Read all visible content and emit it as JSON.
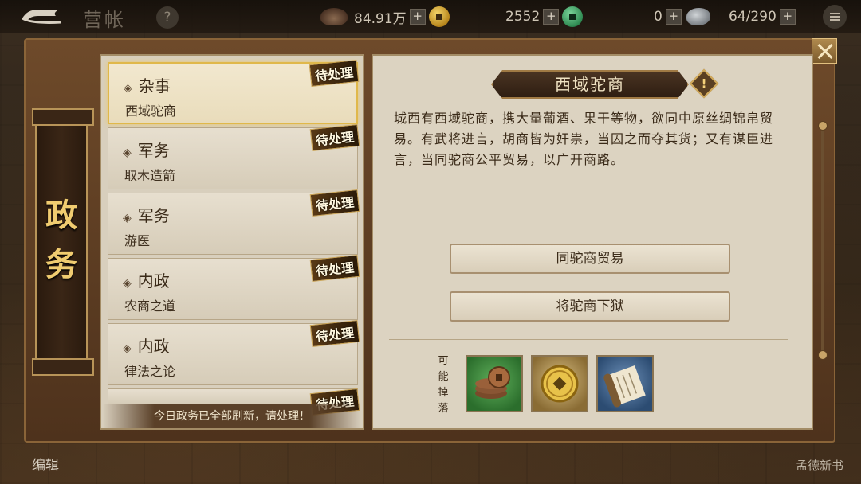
{
  "topbar": {
    "title": "营帐",
    "help_label": "?",
    "resources": [
      {
        "icon": "ingot-icon",
        "value": "84.91万"
      },
      {
        "icon": "jade-coin-icon",
        "value": "2552"
      },
      {
        "icon": "stone-icon",
        "value": "0"
      },
      {
        "icon": "capacity",
        "value": "64/290"
      }
    ],
    "plus_label": "+"
  },
  "sidebar": {
    "title": "政务"
  },
  "affairs": {
    "pending_label": "待处理",
    "partial_label": "待处理",
    "items": [
      {
        "category": "杂事",
        "name": "西域驼商",
        "selected": true
      },
      {
        "category": "军务",
        "name": "取木造箭",
        "selected": false
      },
      {
        "category": "军务",
        "name": "游医",
        "selected": false
      },
      {
        "category": "内政",
        "name": "农商之道",
        "selected": false
      },
      {
        "category": "内政",
        "name": "律法之论",
        "selected": false
      }
    ],
    "footer": "今日政务已全部刷新，请处理！"
  },
  "detail": {
    "title": "西域驼商",
    "alert_label": "!",
    "description": "城西有西域驼商，携大量葡酒、果干等物，欲同中原丝绸锦帛贸易。有武将进言，胡商皆为奸祟，当囚之而夺其货；又有谋臣进言，当同驼商公平贸易，以广开商路。",
    "choices": [
      "同驼商贸易",
      "将驼商下狱"
    ],
    "drops_label": "可能掉落",
    "drops": [
      {
        "icon": "copper-coins-icon"
      },
      {
        "icon": "gold-coin-icon"
      },
      {
        "icon": "scroll-icon"
      }
    ]
  },
  "footer": {
    "left_label": "编辑",
    "right_label": "孟德新书"
  },
  "colors": {
    "accent_gold": "#e0b84a",
    "panel": "#dcd3c1",
    "frame": "#6e4a2a"
  }
}
